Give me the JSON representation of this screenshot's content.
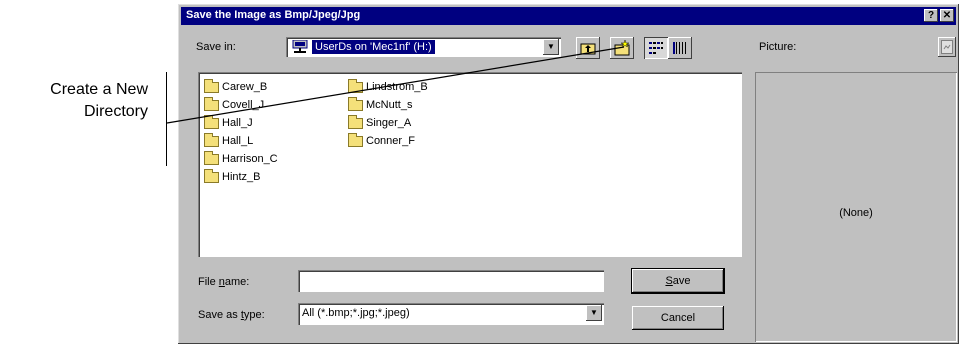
{
  "callout": {
    "line1": "Create a New",
    "line2": "Directory"
  },
  "dialog": {
    "title": "Save the Image as Bmp/Jpeg/Jpg",
    "help_button": "?",
    "close_button": "✕",
    "save_in_label": "Save in:",
    "save_in_value": "UserDs on 'Mec1nf' (H:)",
    "picture_label": "Picture:",
    "picture_value": "(None)",
    "folders_col1": [
      "Carew_B",
      "Covell_J",
      "Hall_J",
      "Hall_L",
      "Harrison_C",
      "Hintz_B"
    ],
    "folders_col2": [
      "Lindstrom_B",
      "McNutt_s",
      "Singer_A",
      "Conner_F"
    ],
    "file_name_label_pre": "File ",
    "file_name_label_u": "n",
    "file_name_label_post": "ame:",
    "file_name_value": "",
    "save_type_label_pre": "Save as ",
    "save_type_label_u": "t",
    "save_type_label_post": "ype:",
    "save_type_value": "All (*.bmp;*.jpg;*.jpeg)",
    "save_button_u": "S",
    "save_button_rest": "ave",
    "cancel_button": "Cancel"
  },
  "icons": {
    "drive": "network-drive-icon",
    "up": "up-one-level-icon",
    "new_folder": "create-new-folder-icon",
    "list": "list-view-icon",
    "details": "details-view-icon",
    "preview": "preview-icon"
  }
}
